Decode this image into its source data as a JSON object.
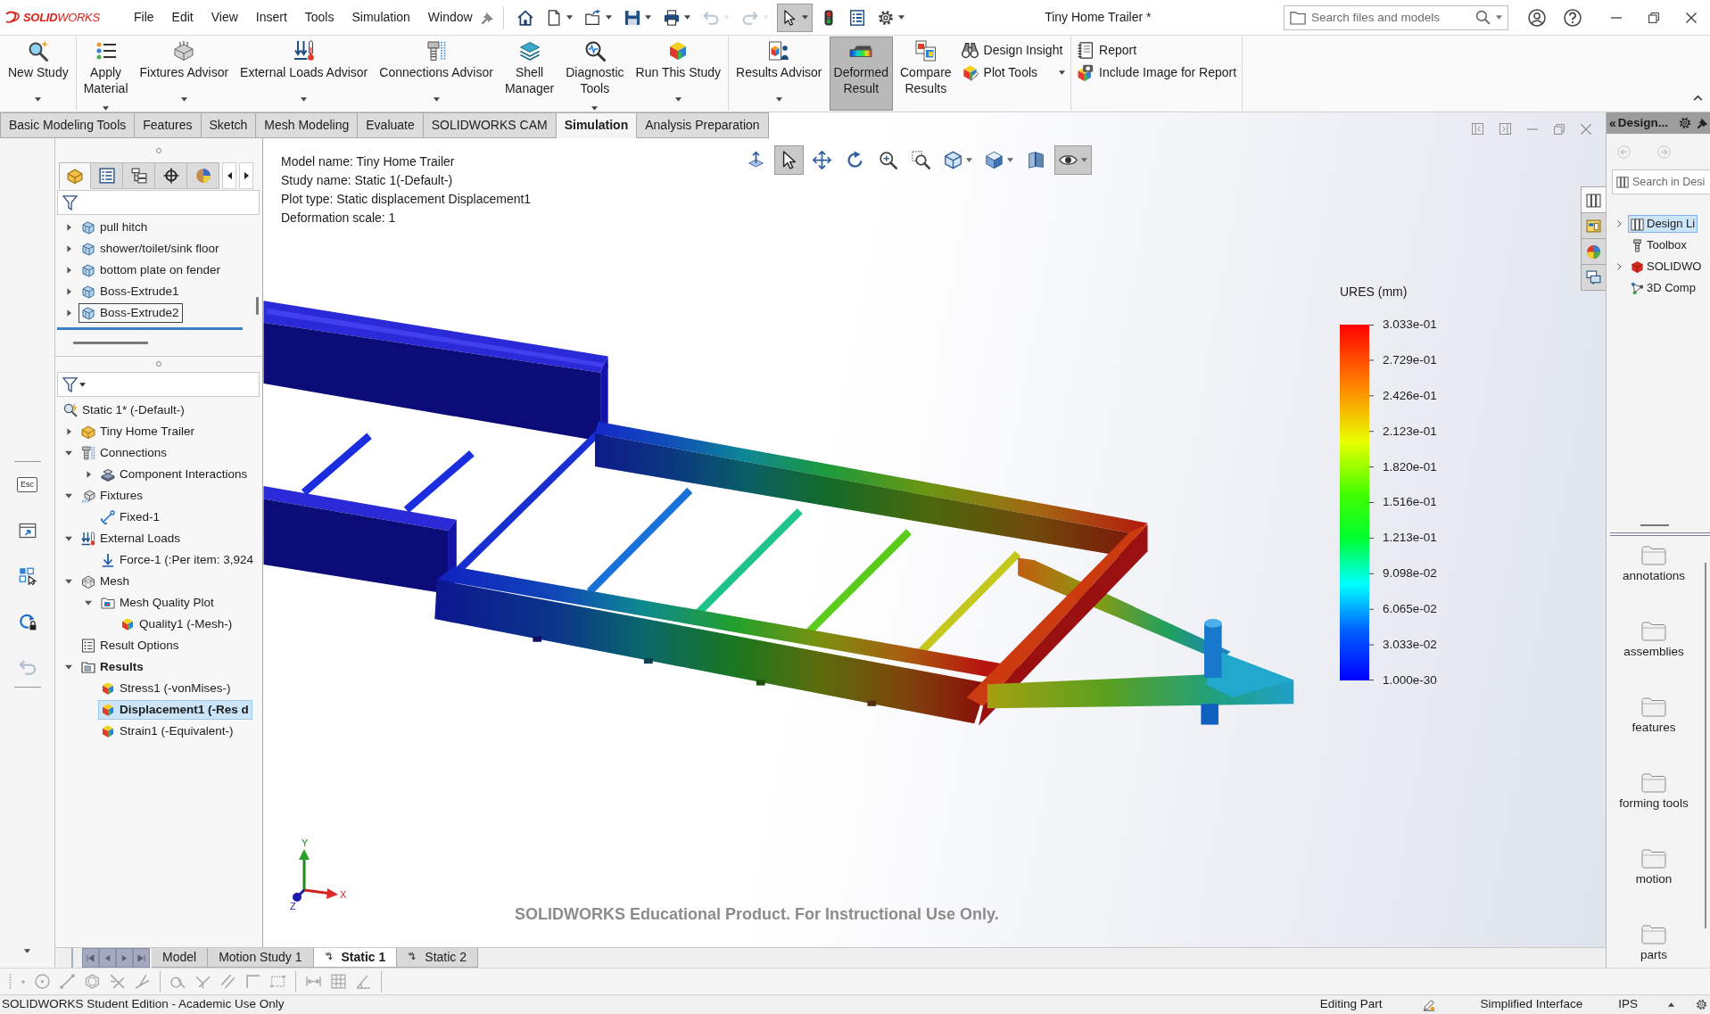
{
  "logo": {
    "text": "**SOLID**WORKS"
  },
  "menu": [
    "File",
    "Edit",
    "View",
    "Insert",
    "Tools",
    "Simulation",
    "Window"
  ],
  "quick_access": [
    {
      "kind": "home",
      "dropdown": false,
      "disabled": false,
      "on": false
    },
    {
      "kind": "new",
      "dropdown": true,
      "disabled": false,
      "on": false
    },
    {
      "kind": "open",
      "dropdown": true,
      "disabled": false,
      "on": false
    },
    {
      "kind": "save",
      "dropdown": true,
      "disabled": false,
      "on": false
    },
    {
      "kind": "print",
      "dropdown": true,
      "disabled": false,
      "on": false
    },
    {
      "kind": "undo",
      "dropdown": true,
      "disabled": true,
      "on": false
    },
    {
      "kind": "redo",
      "dropdown": true,
      "disabled": true,
      "on": false
    },
    {
      "kind": "select",
      "dropdown": true,
      "disabled": false,
      "on": true
    },
    {
      "kind": "rebuild",
      "dropdown": false,
      "disabled": false,
      "on": false
    },
    {
      "kind": "properties",
      "dropdown": false,
      "disabled": false,
      "on": false
    },
    {
      "kind": "options",
      "dropdown": true,
      "disabled": false,
      "on": false
    }
  ],
  "document_title": "Tiny Home Trailer *",
  "search": {
    "placeholder": "Search files and models"
  },
  "ribbon": [
    {
      "buttons": [
        {
          "kind": "study",
          "label": "New Study",
          "dropdown": true,
          "on": false
        }
      ]
    },
    {
      "buttons": [
        {
          "kind": "material",
          "label": "Apply\nMaterial",
          "dropdown": true,
          "on": false
        },
        {
          "kind": "fixtures",
          "label": "Fixtures Advisor",
          "dropdown": true,
          "on": false
        },
        {
          "kind": "loads",
          "label": "External Loads Advisor",
          "dropdown": true,
          "on": false
        },
        {
          "kind": "connections",
          "label": "Connections Advisor",
          "dropdown": true,
          "on": false
        },
        {
          "kind": "shell",
          "label": "Shell\nManager",
          "dropdown": false,
          "on": false
        },
        {
          "kind": "diagnostic",
          "label": "Diagnostic\nTools",
          "dropdown": true,
          "on": false
        },
        {
          "kind": "run",
          "label": "Run This Study",
          "dropdown": true,
          "on": false
        }
      ]
    },
    {
      "buttons": [
        {
          "kind": "advisor",
          "label": "Results Advisor",
          "dropdown": true,
          "on": false
        },
        {
          "kind": "deformed",
          "label": "Deformed\nResult",
          "dropdown": false,
          "on": true
        },
        {
          "kind": "compare",
          "label": "Compare\nResults",
          "dropdown": false,
          "on": false
        }
      ],
      "small": [
        {
          "kind": "insight",
          "label": "Design Insight",
          "dropdown": false
        },
        {
          "kind": "plottools",
          "label": "Plot Tools",
          "dropdown": true
        }
      ]
    },
    {
      "small": [
        {
          "kind": "report",
          "label": "Report",
          "dropdown": false
        },
        {
          "kind": "image",
          "label": "Include Image for Report",
          "dropdown": false
        }
      ]
    }
  ],
  "command_tabs": [
    {
      "label": "Basic Modeling Tools",
      "selected": false
    },
    {
      "label": "Features",
      "selected": false
    },
    {
      "label": "Sketch",
      "selected": false
    },
    {
      "label": "Mesh Modeling",
      "selected": false
    },
    {
      "label": "Evaluate",
      "selected": false
    },
    {
      "label": "SOLIDWORKS CAM",
      "selected": false
    },
    {
      "label": "Simulation",
      "selected": true
    },
    {
      "label": "Analysis Preparation",
      "selected": false
    }
  ],
  "left_strip": [
    {
      "kind": "key",
      "label": "Esc",
      "disabled": false
    },
    {
      "kind": "window",
      "disabled": false
    },
    {
      "kind": "squares",
      "disabled": false
    },
    {
      "kind": "lock",
      "disabled": false
    },
    {
      "kind": "undo",
      "disabled": true
    }
  ],
  "feature_manager": {
    "tabs": [
      {
        "kind": "features",
        "selected": true
      },
      {
        "kind": "property",
        "selected": false
      },
      {
        "kind": "configuration",
        "selected": false
      },
      {
        "kind": "dimxpert",
        "selected": false
      },
      {
        "kind": "display",
        "selected": false
      }
    ],
    "feature_tree": [
      {
        "label": "pull hitch",
        "expanded": false,
        "focused": false
      },
      {
        "label": "shower/toilet/sink floor",
        "expanded": false,
        "focused": false
      },
      {
        "label": "bottom plate on fender",
        "expanded": false,
        "focused": false
      },
      {
        "label": "Boss-Extrude1",
        "expanded": false,
        "focused": false
      },
      {
        "label": "Boss-Extrude2",
        "expanded": false,
        "focused": true
      }
    ],
    "study_tree": [
      {
        "kind": "study",
        "label": "Static 1* (-Default-)",
        "selected": false,
        "active": false,
        "children": [
          {
            "kind": "part",
            "label": "Tiny Home Trailer",
            "expanded": false,
            "selected": false,
            "active": false
          },
          {
            "kind": "connections",
            "label": "Connections",
            "expanded": true,
            "selected": false,
            "active": false,
            "children": [
              {
                "kind": "interactions",
                "label": "Component Interactions",
                "expanded": false,
                "selected": false,
                "active": false
              }
            ]
          },
          {
            "kind": "fixtures",
            "label": "Fixtures",
            "expanded": true,
            "selected": false,
            "active": false,
            "children": [
              {
                "kind": "fixed",
                "label": "Fixed-1",
                "selected": false,
                "active": false
              }
            ]
          },
          {
            "kind": "loads",
            "label": "External Loads",
            "expanded": true,
            "selected": false,
            "active": false,
            "children": [
              {
                "kind": "force",
                "label": "Force-1 (:Per item: 3,924",
                "selected": false,
                "active": false
              }
            ]
          },
          {
            "kind": "mesh",
            "label": "Mesh",
            "expanded": true,
            "selected": false,
            "active": false,
            "children": [
              {
                "kind": "plotfolder",
                "label": "Mesh Quality Plot",
                "expanded": true,
                "selected": false,
                "active": false,
                "children": [
                  {
                    "kind": "plot",
                    "label": "Quality1 (-Mesh-)",
                    "selected": false,
                    "active": false
                  }
                ]
              }
            ]
          },
          {
            "kind": "options",
            "label": "Result Options",
            "selected": false,
            "active": false
          },
          {
            "kind": "results",
            "label": "Results",
            "expanded": true,
            "selected": false,
            "active": true,
            "children": [
              {
                "kind": "plot",
                "label": "Stress1 (-vonMises-)",
                "selected": false,
                "active": false
              },
              {
                "kind": "plot",
                "label": "Displacement1 (-Res d",
                "selected": true,
                "active": true
              },
              {
                "kind": "plot",
                "label": "Strain1 (-Equivalent-)",
                "selected": false,
                "active": false
              }
            ]
          }
        ]
      }
    ]
  },
  "viewport": {
    "info": [
      "Model name: Tiny Home Trailer",
      "Study name: Static 1(-Default-)",
      "Plot type: Static displacement Displacement1",
      "Deformation scale: 1"
    ],
    "toolbar": [
      {
        "kind": "normal",
        "on": false,
        "dropdown": false
      },
      {
        "kind": "select",
        "on": true,
        "dropdown": false
      },
      {
        "kind": "pan",
        "on": false,
        "dropdown": false
      },
      {
        "kind": "rotate",
        "on": false,
        "dropdown": false
      },
      {
        "kind": "fit",
        "on": false,
        "dropdown": false
      },
      {
        "kind": "area",
        "on": false,
        "dropdown": false
      },
      {
        "kind": "orientation",
        "on": false,
        "dropdown": true
      },
      {
        "kind": "style",
        "on": false,
        "dropdown": true
      },
      {
        "kind": "section",
        "on": false,
        "dropdown": false
      },
      {
        "kind": "visibility",
        "on": true,
        "dropdown": true
      }
    ],
    "legend": {
      "title": "URES (mm)",
      "labels": [
        "3.033e-01",
        "2.729e-01",
        "2.426e-01",
        "2.123e-01",
        "1.820e-01",
        "1.516e-01",
        "1.213e-01",
        "9.098e-02",
        "6.065e-02",
        "3.033e-02",
        "1.000e-30"
      ]
    },
    "triad": {
      "x": "X",
      "y": "Y",
      "z": "Z"
    },
    "notice": "SOLIDWORKS Educational Product. For Instructional Use Only."
  },
  "task_pane": {
    "tabs": [
      {
        "kind": "library",
        "selected": true
      },
      {
        "kind": "explorer",
        "selected": false
      },
      {
        "kind": "appearances",
        "selected": false
      },
      {
        "kind": "properties",
        "selected": false
      }
    ],
    "collapse": "«",
    "title": "Design...",
    "search": {
      "placeholder": "Search in Desi"
    },
    "tree": [
      {
        "kind": "library",
        "label": "Design Li",
        "expanded": false,
        "selected": true
      },
      {
        "kind": "toolbox",
        "label": "Toolbox",
        "selected": false
      },
      {
        "kind": "content",
        "label": "SOLIDWO",
        "expanded": false,
        "selected": false
      },
      {
        "kind": "components",
        "label": "3D Comp",
        "selected": false
      }
    ],
    "folders": [
      "annotations",
      "assemblies",
      "features",
      "forming tools",
      "motion",
      "parts"
    ]
  },
  "bottom_tabs": [
    {
      "kind": "model",
      "label": "Model",
      "selected": false
    },
    {
      "kind": "motion",
      "label": "Motion Study 1",
      "selected": false
    },
    {
      "kind": "study",
      "label": "Static 1",
      "selected": true
    },
    {
      "kind": "study",
      "label": "Static 2",
      "selected": false
    }
  ],
  "sketch_toolbar": [
    [
      {
        "kind": "point",
        "disabled": true
      },
      {
        "kind": "circle",
        "disabled": true
      },
      {
        "kind": "line",
        "disabled": true
      },
      {
        "kind": "polygon",
        "disabled": true
      },
      {
        "kind": "trim",
        "disabled": true
      },
      {
        "kind": "extend",
        "disabled": true
      }
    ],
    [
      {
        "kind": "convert",
        "disabled": true
      },
      {
        "kind": "offset",
        "disabled": true
      },
      {
        "kind": "mirror",
        "disabled": true
      },
      {
        "kind": "fillet",
        "disabled": true
      },
      {
        "kind": "pattern",
        "disabled": true
      }
    ],
    [
      {
        "kind": "dimension",
        "disabled": true
      },
      {
        "kind": "grid",
        "disabled": true
      },
      {
        "kind": "angle",
        "disabled": true
      }
    ]
  ],
  "status_bar": {
    "message": "SOLIDWORKS Student Edition - Academic Use Only",
    "mode": "Editing Part",
    "interface": "Simplified Interface",
    "units": "IPS"
  }
}
